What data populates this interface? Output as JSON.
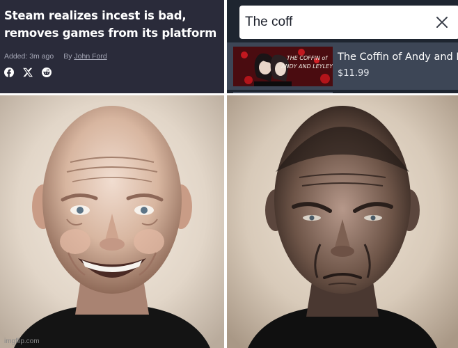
{
  "article": {
    "title_line1": "Steam realizes incest is bad,",
    "title_line2": "removes games from its platform",
    "added_label": "Added: 3m ago",
    "by_label": "By",
    "author": "John Ford",
    "share_icons": [
      "facebook-icon",
      "x-icon",
      "reddit-icon"
    ]
  },
  "search": {
    "value": "The coff",
    "clear_icon": "close-icon",
    "result": {
      "title": "The Coffin of Andy and Leyley",
      "price": "$11.99",
      "capsule_text": "THE COFFIN OF ANDY AND LEYLEY"
    }
  },
  "panels": {
    "left": "happy-bald-man-portrait",
    "right": "angry-bald-man-portrait"
  },
  "watermark": "imgflip.com",
  "colors": {
    "article_bg": "#2a2b3a",
    "steam_bg": "#1e2530",
    "result_row_bg": "#3d4656",
    "capsule_red": "#5c0e12"
  }
}
